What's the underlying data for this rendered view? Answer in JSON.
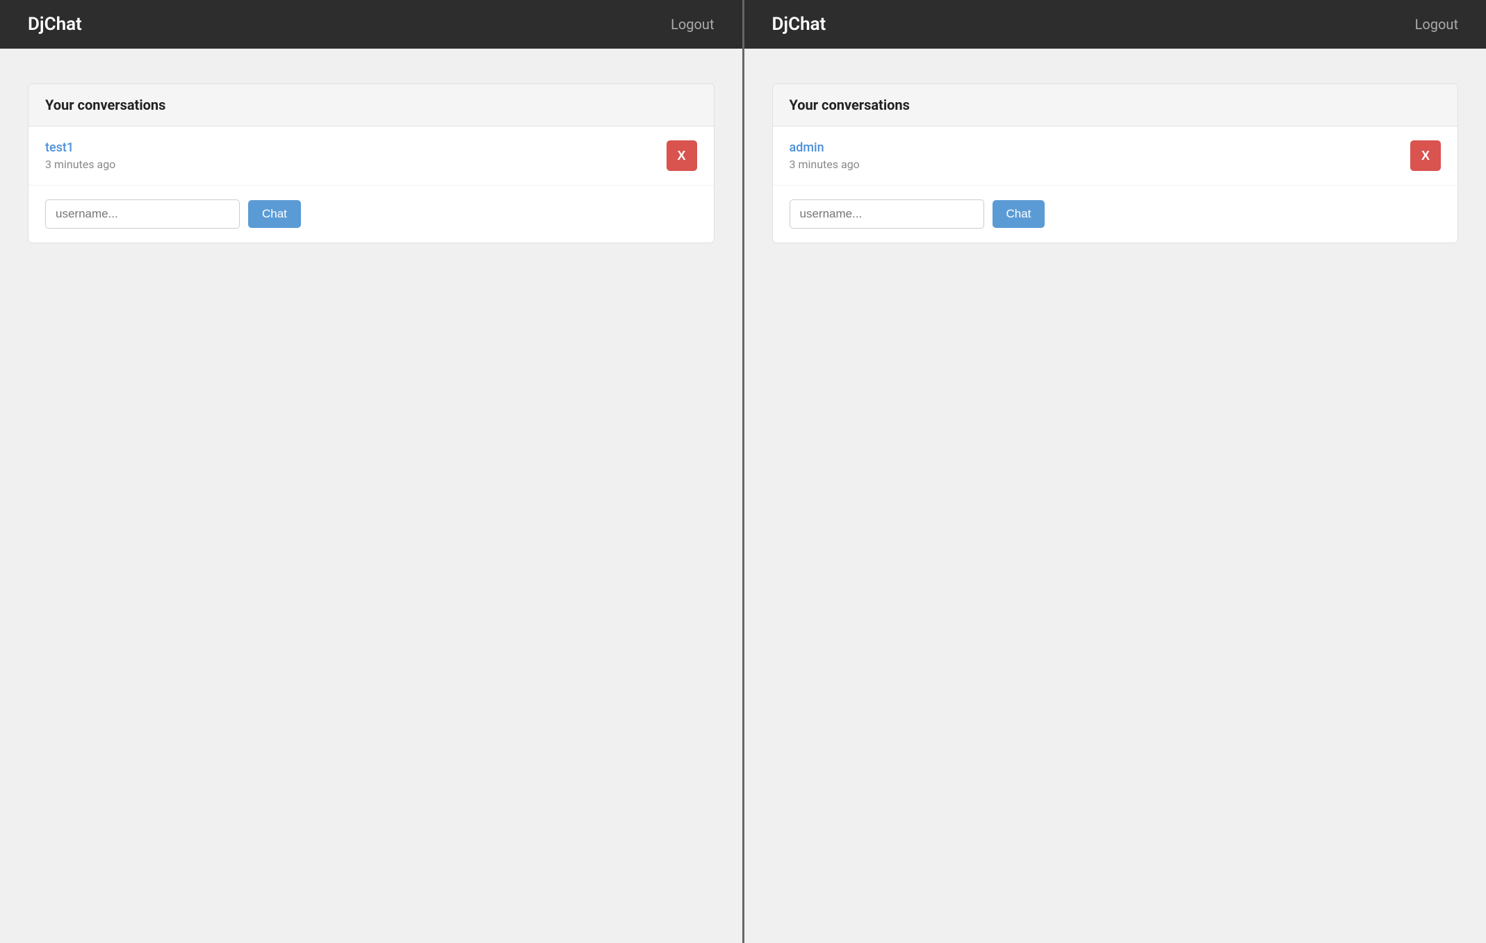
{
  "panels": [
    {
      "id": "panel-left",
      "navbar": {
        "brand": "DjChat",
        "logout_label": "Logout"
      },
      "conversations": {
        "section_title": "Your conversations",
        "items": [
          {
            "username": "test1",
            "time": "3 minutes ago",
            "delete_label": "X"
          }
        ],
        "new_chat": {
          "placeholder": "username...",
          "button_label": "Chat"
        }
      }
    },
    {
      "id": "panel-right",
      "navbar": {
        "brand": "DjChat",
        "logout_label": "Logout"
      },
      "conversations": {
        "section_title": "Your conversations",
        "items": [
          {
            "username": "admin",
            "time": "3 minutes ago",
            "delete_label": "X"
          }
        ],
        "new_chat": {
          "placeholder": "username...",
          "button_label": "Chat"
        }
      }
    }
  ]
}
